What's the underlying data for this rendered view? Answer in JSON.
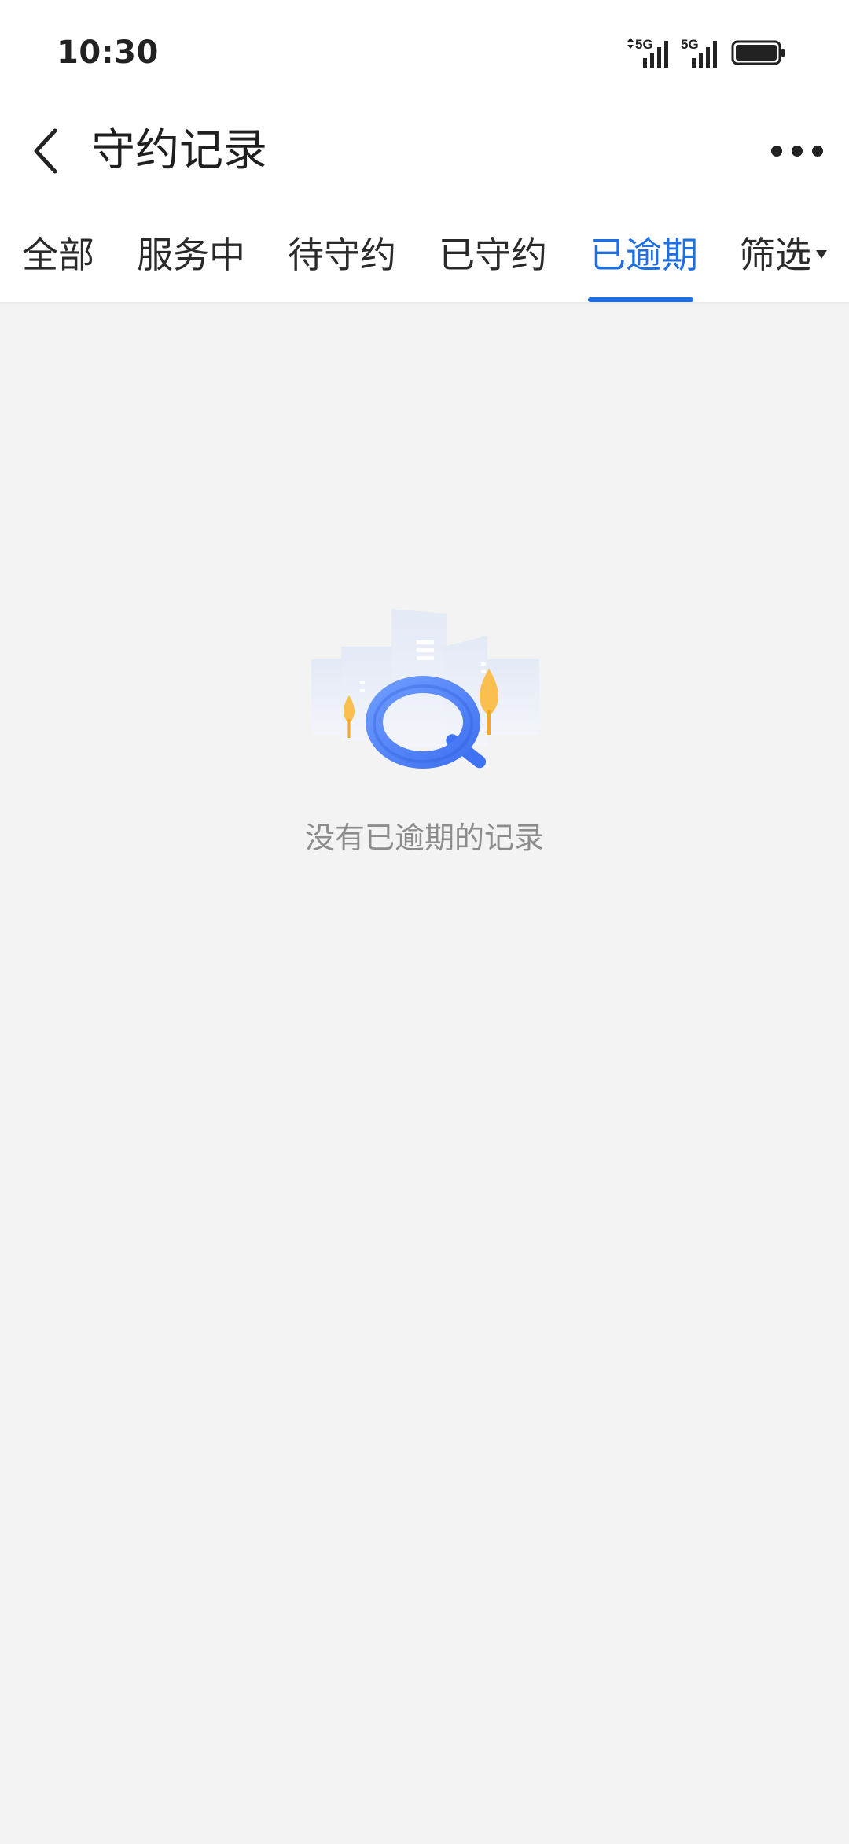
{
  "status_bar": {
    "time": "10:30",
    "network_1": "5G",
    "network_2": "5G"
  },
  "header": {
    "title": "守约记录",
    "back_icon": "chevron-left-icon",
    "more_icon": "more-horizontal-icon"
  },
  "tabs": [
    {
      "label": "全部",
      "active": false
    },
    {
      "label": "服务中",
      "active": false
    },
    {
      "label": "待守约",
      "active": false
    },
    {
      "label": "已守约",
      "active": false
    },
    {
      "label": "已逾期",
      "active": true
    },
    {
      "label": "筛选",
      "active": false
    }
  ],
  "empty_state": {
    "message": "没有已逾期的记录",
    "icon": "search-magnifier-illustration"
  },
  "colors": {
    "accent": "#1f6fe0",
    "background": "#f3f3f3",
    "text_muted": "#8c8c8c"
  }
}
